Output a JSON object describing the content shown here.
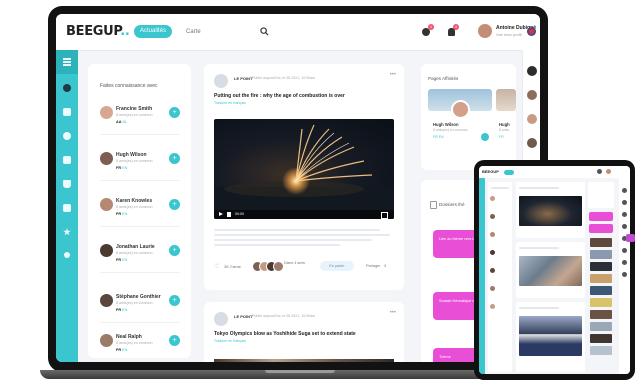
{
  "app": {
    "logo": "BEEGUP",
    "logo_dots": ".."
  },
  "topbar": {
    "tabs": [
      {
        "label": "Actualités"
      },
      {
        "label": "Carte"
      }
    ],
    "chat_badge": "1",
    "notif_badge": "4",
    "user": {
      "name": "Antoine Dubigné",
      "subtitle": "Voir mon profil"
    }
  },
  "sidebar": {
    "icons": [
      "menu-icon",
      "globe-icon",
      "news-icon",
      "gear-icon",
      "grid-icon",
      "bag-icon",
      "list-icon",
      "star-icon",
      "dot-icon"
    ]
  },
  "suggestions": {
    "title": "Faites connaissance avec",
    "people": [
      {
        "name": "Francine Smith",
        "sub": "8 amis(es) en commun",
        "tags": [
          "AA",
          "NL"
        ]
      },
      {
        "name": "Hugh Wilson",
        "sub": "8 amis(es) en commun",
        "tags": [
          "FR",
          "EN"
        ]
      },
      {
        "name": "Karen Knowles",
        "sub": "8 amis(es) en commun",
        "tags": [
          "FR",
          "EN"
        ]
      },
      {
        "name": "Jonathan Laurie",
        "sub": "8 amis(es) en commun",
        "tags": [
          "FR",
          "EN"
        ]
      },
      {
        "name": "Stéphane Gonthier",
        "sub": "8 amis(es) en commun",
        "tags": [
          "FR",
          "EN"
        ]
      },
      {
        "name": "Neal Ralph",
        "sub": "8 amis(es) en commun",
        "tags": [
          "FR",
          "EN"
        ]
      }
    ]
  },
  "feed": {
    "post1": {
      "source": "LE POINT",
      "time": "Publié aujourd'hui, le 08 2021, 10:00am",
      "title": "Putting out the fire : why the age of combustion is over",
      "subtitle": "Traduire en français",
      "video_time": "00:00",
      "likes": "36 J'aime",
      "commenters": "Diane 4 amis",
      "repost": "En parler",
      "share": "Partager",
      "share_count": "3"
    },
    "post2": {
      "source": "LE POINT",
      "time": "Publié aujourd'hui, le 08 2021, 10:00am",
      "title": "Tokyo Olympics blow as Yoshihide Suga set to extend state",
      "subtitle": "Traduire en français"
    }
  },
  "pages": {
    "title": "Pages Affinités",
    "items": [
      {
        "name": "Hugh Wilson",
        "sub": "8 amis(es) en commun",
        "tags": "FR EN"
      },
      {
        "name": "Hugh",
        "sub": "8 amis",
        "tags": "FR"
      }
    ]
  },
  "themes": {
    "title": "Dossiers thé",
    "buttons": [
      {
        "label": "Lien du thème vers la liste thématique"
      },
      {
        "label": "Sociale thématique de la semaine"
      },
      {
        "label": "Thème"
      }
    ]
  },
  "tablet": {
    "logo": "BEEGUP"
  },
  "colors": {
    "accent": "#3bc6cf",
    "pink": "#e84fd6",
    "badge": "#f3546b"
  }
}
